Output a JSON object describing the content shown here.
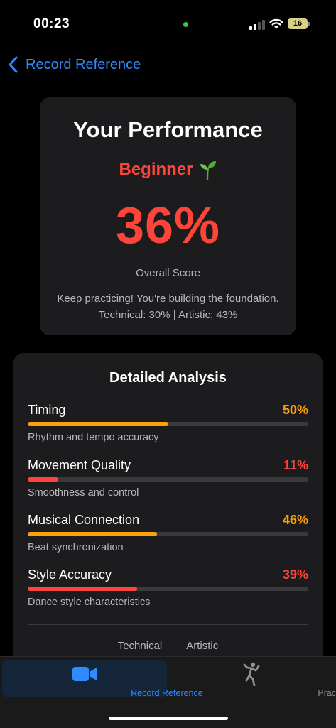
{
  "status": {
    "time": "00:23",
    "battery": "16"
  },
  "nav": {
    "back_label": "Record Reference"
  },
  "performance": {
    "title": "Your Performance",
    "level": "Beginner",
    "level_icon": "seedling-icon",
    "score": "36%",
    "score_fraction": 0.36,
    "score_label": "Overall Score",
    "message": "Keep practicing! You're building the foundation.",
    "breakdown": "Technical: 30% | Artistic: 43%"
  },
  "analysis": {
    "title": "Detailed Analysis",
    "metrics": [
      {
        "name": "Timing",
        "value": "50%",
        "fraction": 0.5,
        "desc": "Rhythm and tempo accuracy",
        "color": "#ff9f0a"
      },
      {
        "name": "Movement Quality",
        "value": "11%",
        "fraction": 0.11,
        "desc": "Smoothness and control",
        "color": "#ff453a"
      },
      {
        "name": "Musical Connection",
        "value": "46%",
        "fraction": 0.46,
        "desc": "Beat synchronization",
        "color": "#ff9f0a"
      },
      {
        "name": "Style Accuracy",
        "value": "39%",
        "fraction": 0.39,
        "desc": "Dance style characteristics",
        "color": "#ff453a"
      }
    ],
    "sub_tabs": [
      "Technical",
      "Artistic"
    ]
  },
  "tabbar": {
    "items": [
      {
        "label": "Record Reference",
        "icon": "video-camera-icon",
        "active": true
      },
      {
        "label": "Practice",
        "icon": "dancer-icon",
        "active": false
      }
    ]
  },
  "colors": {
    "accent": "#2f8cff",
    "danger": "#ff453a",
    "warning": "#ff9f0a"
  }
}
